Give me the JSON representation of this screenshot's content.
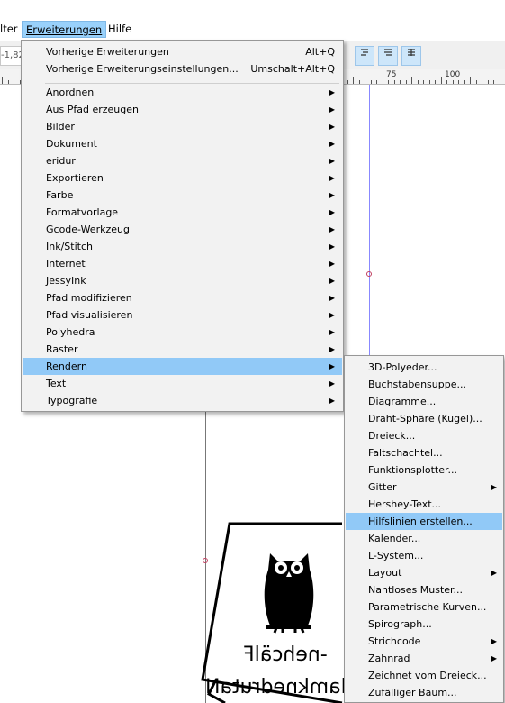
{
  "menubar": {
    "partial_left": "lter",
    "extensions": "Erweiterungen",
    "help": "Hilfe"
  },
  "toolbar": {
    "coord_value": "-1,82"
  },
  "ruler": {
    "labels": [
      "75",
      "100"
    ]
  },
  "menu": {
    "top_items": [
      {
        "label": "Vorherige Erweiterungen",
        "shortcut": "Alt+Q"
      },
      {
        "label": "Vorherige Erweiterungseinstellungen...",
        "shortcut": "Umschalt+Alt+Q"
      }
    ],
    "items": [
      {
        "label": "Anordnen",
        "submenu": true,
        "highlighted": false
      },
      {
        "label": "Aus Pfad erzeugen",
        "submenu": true,
        "highlighted": false
      },
      {
        "label": "Bilder",
        "submenu": true,
        "highlighted": false
      },
      {
        "label": "Dokument",
        "submenu": true,
        "highlighted": false
      },
      {
        "label": "eridur",
        "submenu": true,
        "highlighted": false
      },
      {
        "label": "Exportieren",
        "submenu": true,
        "highlighted": false
      },
      {
        "label": "Farbe",
        "submenu": true,
        "highlighted": false
      },
      {
        "label": "Formatvorlage",
        "submenu": true,
        "highlighted": false
      },
      {
        "label": "Gcode-Werkzeug",
        "submenu": true,
        "highlighted": false
      },
      {
        "label": "Ink/Stitch",
        "submenu": true,
        "highlighted": false
      },
      {
        "label": "Internet",
        "submenu": true,
        "highlighted": false
      },
      {
        "label": "JessyInk",
        "submenu": true,
        "highlighted": false
      },
      {
        "label": "Pfad modifizieren",
        "submenu": true,
        "highlighted": false
      },
      {
        "label": "Pfad visualisieren",
        "submenu": true,
        "highlighted": false
      },
      {
        "label": "Polyhedra",
        "submenu": true,
        "highlighted": false
      },
      {
        "label": "Raster",
        "submenu": true,
        "highlighted": false
      },
      {
        "label": "Rendern",
        "submenu": true,
        "highlighted": true
      },
      {
        "label": "Text",
        "submenu": true,
        "highlighted": false
      },
      {
        "label": "Typografie",
        "submenu": true,
        "highlighted": false
      }
    ]
  },
  "submenu": {
    "items": [
      {
        "label": "3D-Polyeder...",
        "submenu": false,
        "highlighted": false
      },
      {
        "label": "Buchstabensuppe...",
        "submenu": false,
        "highlighted": false
      },
      {
        "label": "Diagramme...",
        "submenu": false,
        "highlighted": false
      },
      {
        "label": "Draht-Sphäre (Kugel)...",
        "submenu": false,
        "highlighted": false
      },
      {
        "label": "Dreieck...",
        "submenu": false,
        "highlighted": false
      },
      {
        "label": "Faltschachtel...",
        "submenu": false,
        "highlighted": false
      },
      {
        "label": "Funktionsplotter...",
        "submenu": false,
        "highlighted": false
      },
      {
        "label": "Gitter",
        "submenu": true,
        "highlighted": false
      },
      {
        "label": "Hershey-Text...",
        "submenu": false,
        "highlighted": false
      },
      {
        "label": "Hilfslinien erstellen...",
        "submenu": false,
        "highlighted": true
      },
      {
        "label": "Kalender...",
        "submenu": false,
        "highlighted": false
      },
      {
        "label": "L-System...",
        "submenu": false,
        "highlighted": false
      },
      {
        "label": "Layout",
        "submenu": true,
        "highlighted": false
      },
      {
        "label": "Nahtloses Muster...",
        "submenu": false,
        "highlighted": false
      },
      {
        "label": "Parametrische Kurven...",
        "submenu": false,
        "highlighted": false
      },
      {
        "label": "Spirograph...",
        "submenu": false,
        "highlighted": false
      },
      {
        "label": "Strichcode",
        "submenu": true,
        "highlighted": false
      },
      {
        "label": "Zahnrad",
        "submenu": true,
        "highlighted": false
      },
      {
        "label": "Zeichnet vom Dreieck...",
        "submenu": false,
        "highlighted": false
      },
      {
        "label": "Zufälliger Baum...",
        "submenu": false,
        "highlighted": false
      }
    ]
  },
  "document": {
    "text_line1": "-nehcälF",
    "text_line2": "lamknedrutaN",
    "icon": "owl-icon"
  },
  "colors": {
    "highlight": "#91c9f7",
    "menubar_active": "#99d1fb",
    "guide": "#8888ff"
  }
}
